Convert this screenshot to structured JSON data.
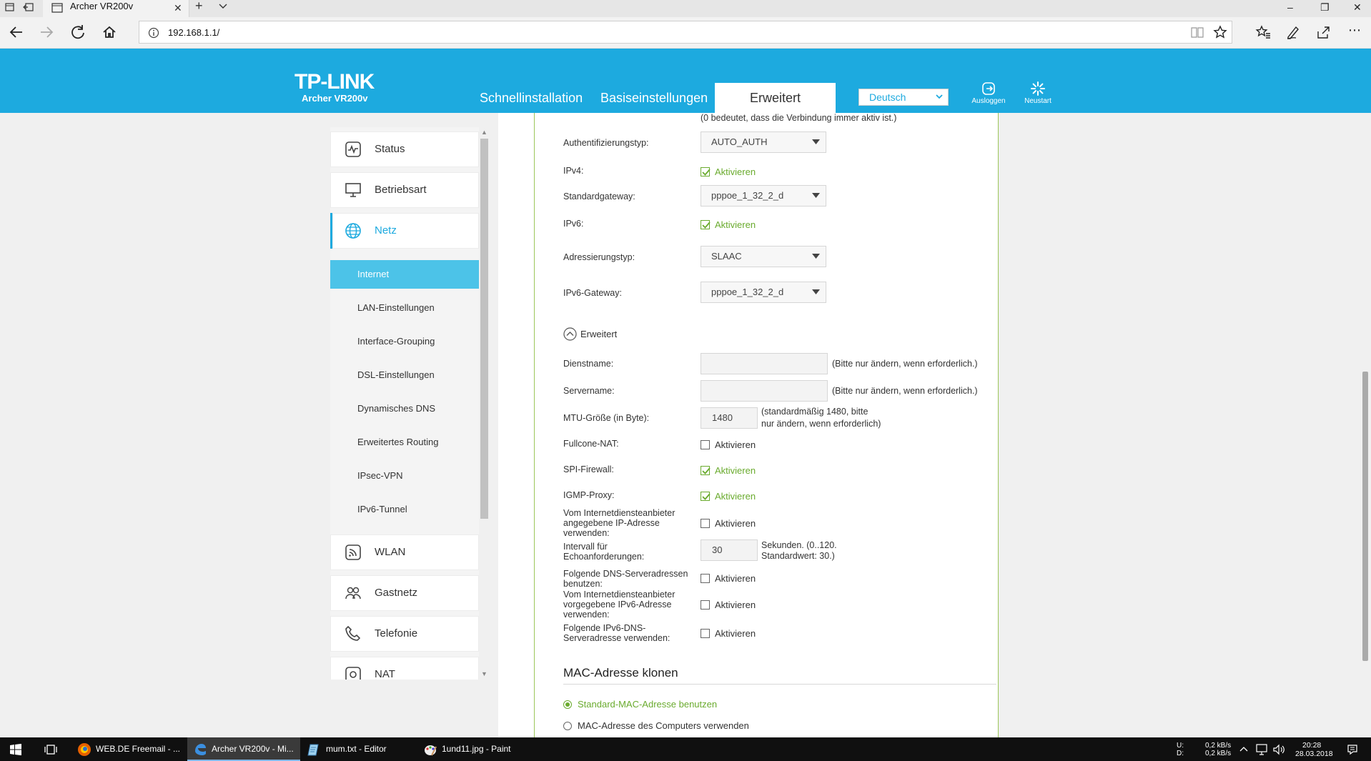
{
  "browser": {
    "tab_title": "Archer VR200v",
    "url": "192.168.1.1/",
    "window_controls": {
      "minimize": "–",
      "maximize": "❐",
      "close": "✕"
    }
  },
  "router": {
    "brand": "TP-LINK",
    "model": "Archer VR200v",
    "nav_tabs": [
      "Schnellinstallation",
      "Basiseinstellungen",
      "Erweitert"
    ],
    "active_tab": "Erweitert",
    "language": "Deutsch",
    "logout_label": "Ausloggen",
    "reboot_label": "Neustart",
    "accent_color": "#1daadf",
    "ok_color": "#6aab2e"
  },
  "sidebar": {
    "items": [
      {
        "label": "Status",
        "icon": "status-icon"
      },
      {
        "label": "Betriebsart",
        "icon": "monitor-icon"
      },
      {
        "label": "Netz",
        "icon": "globe-icon",
        "active": true
      },
      {
        "label": "WLAN",
        "icon": "wifi-icon"
      },
      {
        "label": "Gastnetz",
        "icon": "guest-icon"
      },
      {
        "label": "Telefonie",
        "icon": "phone-icon"
      },
      {
        "label": "NAT",
        "icon": "nat-icon"
      }
    ],
    "subitems": [
      {
        "label": "Internet",
        "active": true
      },
      {
        "label": "LAN-Einstellungen"
      },
      {
        "label": "Interface-Grouping"
      },
      {
        "label": "DSL-Einstellungen"
      },
      {
        "label": "Dynamisches DNS"
      },
      {
        "label": "Erweitertes Routing"
      },
      {
        "label": "IPsec-VPN"
      },
      {
        "label": "IPv6-Tunnel"
      }
    ]
  },
  "form": {
    "top_note": "(0 bedeutet, dass die Verbindung immer aktiv ist.)",
    "auth_label": "Authentifizierungstyp:",
    "auth_value": "AUTO_AUTH",
    "ipv4_label": "IPv4:",
    "activate": "Aktivieren",
    "gateway_label": "Standardgateway:",
    "gateway_value": "pppoe_1_32_2_d",
    "ipv6_label": "IPv6:",
    "addr_label": "Adressierungstyp:",
    "addr_value": "SLAAC",
    "ipv6gw_label": "IPv6-Gateway:",
    "ipv6gw_value": "pppoe_1_32_2_d",
    "advanced_toggle": "Erweitert",
    "service_label": "Dienstname:",
    "service_value": "",
    "server_label": "Servername:",
    "server_value": "",
    "only_if_needed": "(Bitte nur ändern, wenn erforderlich.)",
    "mtu_label": "MTU-Größe (in Byte):",
    "mtu_value": "1480",
    "mtu_hint_1": "(standardmäßig 1480, bitte",
    "mtu_hint_2": "nur ändern, wenn erforderlich)",
    "fullcone_label": "Fullcone-NAT:",
    "spi_label": "SPI-Firewall:",
    "igmp_label": "IGMP-Proxy:",
    "isp_ip_1": "Vom Internetdiensteanbieter",
    "isp_ip_2": "angegebene IP-Adresse",
    "isp_ip_3": "verwenden:",
    "echo_1": "Intervall für",
    "echo_2": "Echoanforderungen:",
    "echo_value": "30",
    "echo_hint_1": "Sekunden. (0..120.",
    "echo_hint_2": "Standardwert: 30.)",
    "dns_1": "Folgende DNS-Serveradressen",
    "dns_2": "benutzen:",
    "isp_ipv6_1": "Vom Internetdiensteanbieter",
    "isp_ipv6_2": "vorgegebene IPv6-Adresse",
    "isp_ipv6_3": "verwenden:",
    "ipv6dns_1": "Folgende IPv6-DNS-",
    "ipv6dns_2": "Serveradresse verwenden:",
    "mac_title": "MAC-Adresse klonen",
    "mac_opt1": "Standard-MAC-Adresse benutzen",
    "mac_opt2": "MAC-Adresse des Computers verwenden"
  },
  "taskbar": {
    "apps": [
      {
        "label": "WEB.DE Freemail - ...",
        "icon": "firefox-icon"
      },
      {
        "label": "Archer VR200v - Mi...",
        "icon": "edge-icon",
        "active": true
      },
      {
        "label": "mum.txt - Editor",
        "icon": "notepad-icon"
      },
      {
        "label": "1und11.jpg - Paint",
        "icon": "paint-icon"
      }
    ],
    "net_u_label": "U:",
    "net_d_label": "D:",
    "net_u": "0,2 kB/s",
    "net_d": "0,2 kB/s",
    "time": "20:28",
    "date": "28.03.2018"
  }
}
